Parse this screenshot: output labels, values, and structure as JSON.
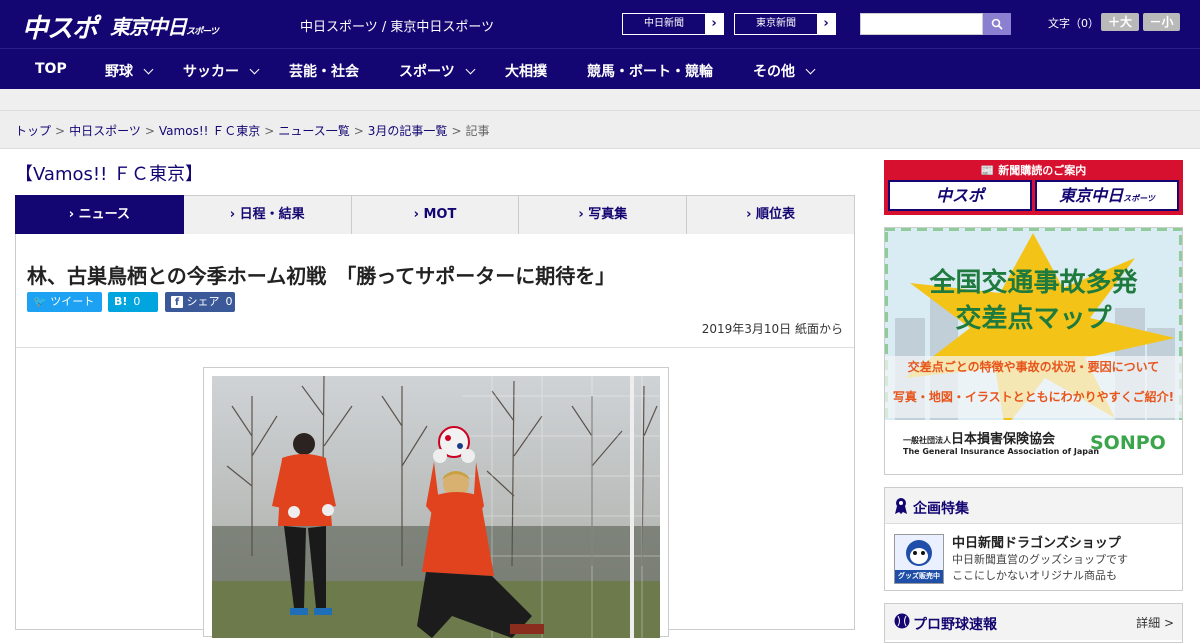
{
  "header": {
    "logo_main": "中スポ",
    "logo_tokyo": "東京中日",
    "logo_tokyo_sub": "スポーツ",
    "site_title": "中日スポーツ / 東京中日スポーツ",
    "ext_links": [
      "中日新聞",
      "東京新聞"
    ],
    "search_placeholder": "",
    "font_size_label": "文字（0）",
    "font_larger": "＋大",
    "font_smaller": "－小"
  },
  "nav": [
    {
      "label": "TOP",
      "dropdown": false
    },
    {
      "label": "野球",
      "dropdown": true
    },
    {
      "label": "サッカー",
      "dropdown": true
    },
    {
      "label": "芸能・社会",
      "dropdown": false
    },
    {
      "label": "スポーツ",
      "dropdown": true
    },
    {
      "label": "大相撲",
      "dropdown": false
    },
    {
      "label": "競馬・ボート・競輪",
      "dropdown": false
    },
    {
      "label": "その他",
      "dropdown": true
    }
  ],
  "breadcrumb": {
    "links": [
      "トップ",
      "中日スポーツ",
      "Vamos!! ＦＣ東京",
      "ニュース一覧",
      "3月の記事一覧"
    ],
    "separator": ">",
    "current": "記事"
  },
  "section_title": "【Vamos!! ＦＣ東京】",
  "tabs": [
    {
      "label": "ニュース",
      "active": true
    },
    {
      "label": "日程・結果",
      "active": false
    },
    {
      "label": "MOT",
      "active": false
    },
    {
      "label": "写真集",
      "active": false
    },
    {
      "label": "順位表",
      "active": false
    }
  ],
  "tab_prefix": "›",
  "article": {
    "headline": "林、古巣鳥栖との今季ホーム初戦　「勝ってサポーターに期待を」",
    "share": {
      "tweet_label": "ツイート",
      "hatena_label": "B!",
      "hatena_count": "0",
      "fb_label": "シェア",
      "fb_count": "0"
    },
    "dateline": "2019年3月10日 紙面から"
  },
  "sidebar": {
    "subscribe_header": "新聞購読のご案内",
    "subscribe_buttons": [
      "中スポ",
      "東京中日"
    ],
    "subscribe_btn2_sub": "スポーツ",
    "traffic_ad": {
      "line1": "全国交通事故多発",
      "line2": "交差点マップ",
      "line3": "交差点ごとの特徴や事故の状況・要因について",
      "line4": "写真・地図・イラストとともにわかりやすくご紹介!",
      "org_prefix": "一般社団法人",
      "org_name": "日本損害保険協会",
      "org_en": "The General Insurance Association of Japan",
      "brand": "SONPO"
    },
    "special": {
      "title": "企画特集",
      "item_title": "中日新聞ドラゴンズショップ",
      "item_desc1": "中日新聞直営のグッズショップです",
      "item_desc2": "ここにしかないオリジナル商品も",
      "item_badge": "グッズ販売中"
    },
    "baseball": {
      "title": "プロ野球速報",
      "detail": "詳細 >"
    }
  },
  "colors": {
    "brand_navy": "#130672",
    "subscribe_red": "#d8102f",
    "twitter": "#1da1f2",
    "hatena": "#00a4de",
    "facebook": "#3b5998"
  }
}
